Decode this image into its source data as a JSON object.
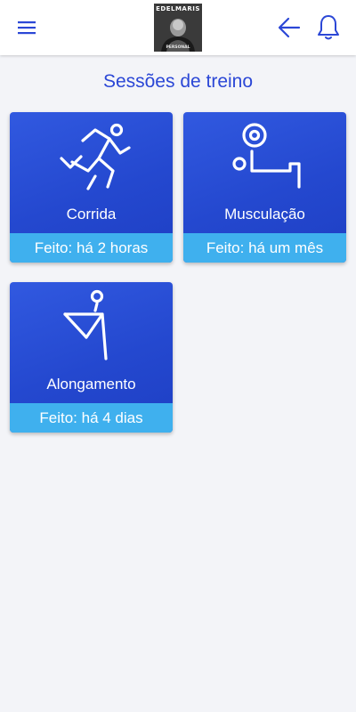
{
  "header": {
    "menu_icon": "hamburger-menu-icon",
    "logo": {
      "top_text": "EDELMARIS",
      "bottom_text": "PERSONAL"
    },
    "back_icon": "arrow-left-icon",
    "bell_icon": "bell-icon"
  },
  "page": {
    "title": "Sessões de treino"
  },
  "sessions": [
    {
      "label": "Corrida",
      "status": "Feito: há 2 horas",
      "icon": "running-icon"
    },
    {
      "label": "Musculação",
      "status": "Feito: há um mês",
      "icon": "weightlifting-icon"
    },
    {
      "label": "Alongamento",
      "status": "Feito: há 4 dias",
      "icon": "stretching-icon"
    }
  ],
  "colors": {
    "accent": "#2b47d6",
    "card_top": "#3159e0",
    "card_bottom": "#1e3fc4",
    "footer": "#3fb0ee",
    "background": "#f3f4f8"
  }
}
